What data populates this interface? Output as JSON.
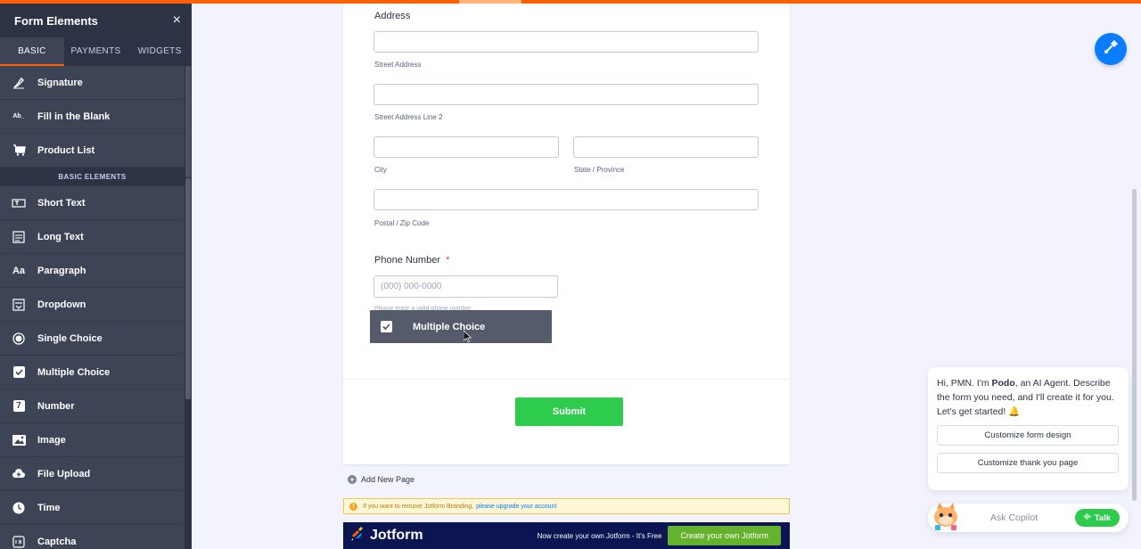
{
  "sidebar": {
    "title": "Form Elements",
    "close_glyph": "×",
    "tabs": [
      {
        "label": "BASIC",
        "active": true
      },
      {
        "label": "PAYMENTS",
        "active": false
      },
      {
        "label": "WIDGETS",
        "active": false
      }
    ],
    "items_top": [
      {
        "label": "Signature",
        "icon": "signature-icon"
      },
      {
        "label": "Fill in the Blank",
        "icon": "fill-blank-icon"
      },
      {
        "label": "Product List",
        "icon": "cart-icon"
      }
    ],
    "section_label": "BASIC ELEMENTS",
    "items": [
      {
        "label": "Short Text",
        "icon": "short-text-icon"
      },
      {
        "label": "Long Text",
        "icon": "long-text-icon"
      },
      {
        "label": "Paragraph",
        "icon": "paragraph-icon"
      },
      {
        "label": "Dropdown",
        "icon": "dropdown-icon"
      },
      {
        "label": "Single Choice",
        "icon": "radio-icon"
      },
      {
        "label": "Multiple Choice",
        "icon": "checkbox-icon"
      },
      {
        "label": "Number",
        "icon": "number-icon"
      },
      {
        "label": "Image",
        "icon": "image-icon"
      },
      {
        "label": "File Upload",
        "icon": "upload-icon"
      },
      {
        "label": "Time",
        "icon": "clock-icon"
      },
      {
        "label": "Captcha",
        "icon": "captcha-icon"
      }
    ],
    "paragraph_glyph": "Aa",
    "number_glyph": "7",
    "fill_blank_glyph": "Ab_"
  },
  "form": {
    "address_label": "Address",
    "street_sub": "Street Address",
    "street2_sub": "Street Address Line 2",
    "city_sub": "City",
    "state_sub": "State / Province",
    "postal_sub": "Postal / Zip Code",
    "phone_label": "Phone Number",
    "required_mark": "*",
    "phone_placeholder": "(000) 000-0000",
    "phone_hint": "Please enter a valid phone number.",
    "submit_label": "Submit"
  },
  "drag_ghost": {
    "label": "Multiple Choice",
    "icon": "checkbox-icon"
  },
  "add_page": {
    "label": "Add New Page",
    "glyph": "+"
  },
  "branding_notice": {
    "text": "If you want to remove Jotform Branding,",
    "link": "please upgrade your account",
    "glyph": "!"
  },
  "footer": {
    "logo_text": "Jotform",
    "cta_text": "Now create your own Jotform - It's Free",
    "cta_button": "Create your own Jotform"
  },
  "chat": {
    "msg_pre": "Hi, PMN. I'm ",
    "agent_name": "Podo",
    "msg_post": ", an AI Agent. Describe the form you need, and I'll create it for you. Let's get started! 🔔",
    "button1": "Customize form design",
    "button2": "Customize thank you page"
  },
  "copilot": {
    "label": "Ask Copilot",
    "talk_label": "Talk"
  },
  "colors": {
    "accent": "#ff6100",
    "submit": "#2ecc4d",
    "sidebar": "#3d4456",
    "footer": "#0a1551",
    "fab": "#0a7cff"
  }
}
